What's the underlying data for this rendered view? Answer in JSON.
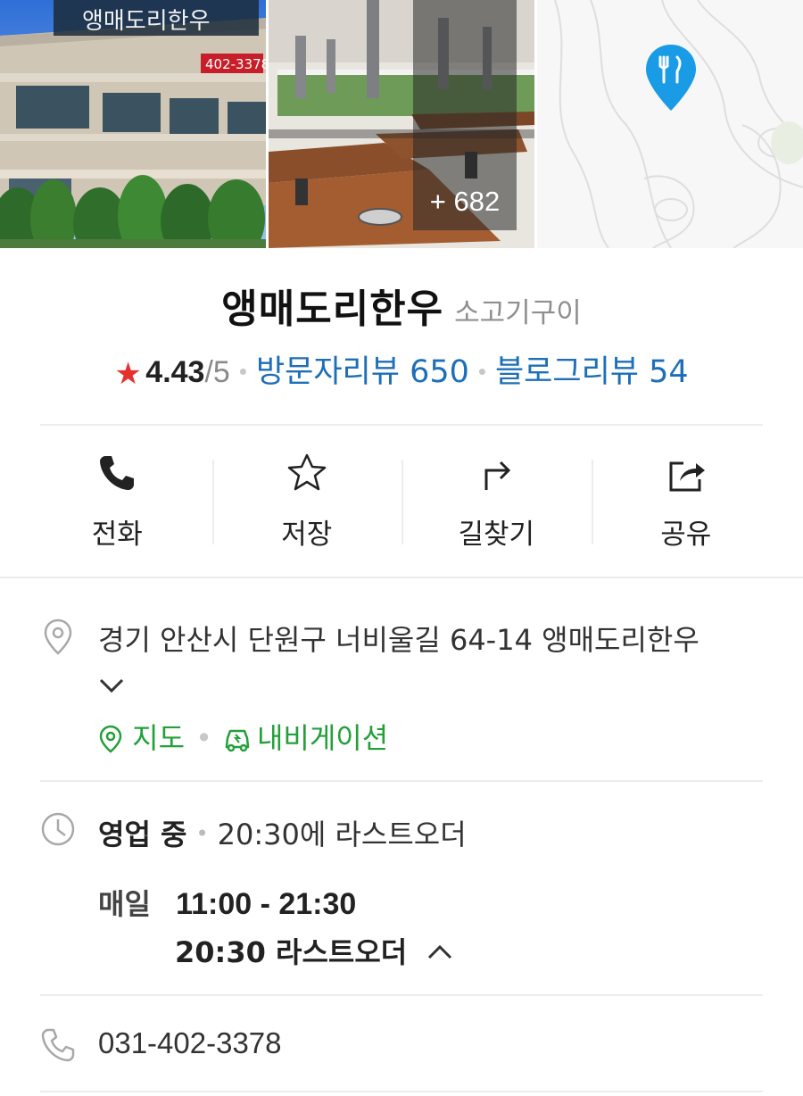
{
  "photos": {
    "more_count": "+ 682",
    "sign_text": "앵매도리한우",
    "sign_phone": "402-3378"
  },
  "place": {
    "name": "앵매도리한우",
    "category": "소고기구이",
    "rating": "4.43",
    "rating_max": "/5",
    "visitor_reviews": "방문자리뷰 650",
    "blog_reviews": "블로그리뷰 54"
  },
  "actions": [
    {
      "label": "전화",
      "icon": "phone-icon"
    },
    {
      "label": "저장",
      "icon": "star-icon"
    },
    {
      "label": "길찾기",
      "icon": "directions-icon"
    },
    {
      "label": "공유",
      "icon": "share-icon"
    }
  ],
  "address": {
    "text": "경기 안산시 단원구 너비울길 64-14 앵매도리한우",
    "map_link": "지도",
    "nav_link": "내비게이션"
  },
  "hours": {
    "status": "영업 중",
    "last_order_note": "20:30에 라스트오더",
    "days": "매일",
    "time": "11:00 - 21:30",
    "last_order": "20:30 라스트오더"
  },
  "phone": {
    "number": "031-402-3378"
  },
  "colors": {
    "accent_blue": "#1e6fb8",
    "accent_green": "#23a03a",
    "star_red": "#e5302e",
    "map_pin": "#1a9be6"
  }
}
